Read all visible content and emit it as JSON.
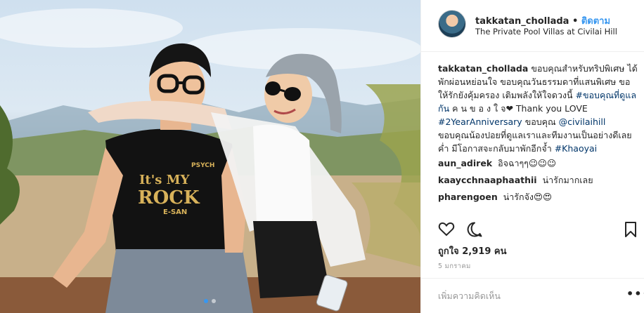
{
  "post": {
    "username": "takkatan_chollada",
    "separator": "•",
    "follow_label": "ติดตาม",
    "location": "The Private Pool Villas at Civilai Hill",
    "shirt_text": {
      "top": "PSYCH",
      "line1": "It's MY",
      "line2": "ROCK",
      "line3": "E-SAN"
    },
    "image_pages": 2,
    "active_page": 1
  },
  "caption": {
    "user": "takkatan_chollada",
    "text1": "ขอบคุณสำหรับทริปพิเศษ ได้พักผ่อนหย่อนใจ ขอบคุณวันธรรมดาที่แสนพิเศษ ขอให้รักยังคุ้มครอง เติมพลังให้ใจดวงนี้",
    "tag1": "#ขอบคุณที่ดูแลกัน",
    "text2": "ค น ข อ ง ใ จ❤ Thank you LOVE",
    "tag2": "#2YearAnniversary",
    "text3": "ขอบคุณ",
    "mention": "@civilaihill",
    "text4": "ขอบคุณน้องปอยที่ดูแลเราและทีมงานเป็นอย่างดีเลยค่ำ มีโอกาสจะกลับมาพักอีกจ้ำ",
    "tag3": "#Khaoyai"
  },
  "comments": [
    {
      "user": "aun_adirek",
      "text": "อิจฉาๆๆ😉😉😉"
    },
    {
      "user": "kaaycchnaaphaathii",
      "text": "น่ารักมากเลย"
    },
    {
      "user": "pharengoen",
      "text": "น่ารักจัง😍😍"
    }
  ],
  "likes": {
    "label": "ถูกใจ",
    "count": "2,919",
    "unit": "คน"
  },
  "timestamp": "5 มกราคม",
  "add_comment": {
    "placeholder": "เพิ่มความคิดเห็น",
    "more": "•••"
  },
  "icons": {
    "like": "heart-icon",
    "comment": "comment-bubble-icon",
    "save": "bookmark-icon"
  },
  "colors": {
    "link": "#003569",
    "follow": "#3897f0",
    "muted": "#999999"
  }
}
